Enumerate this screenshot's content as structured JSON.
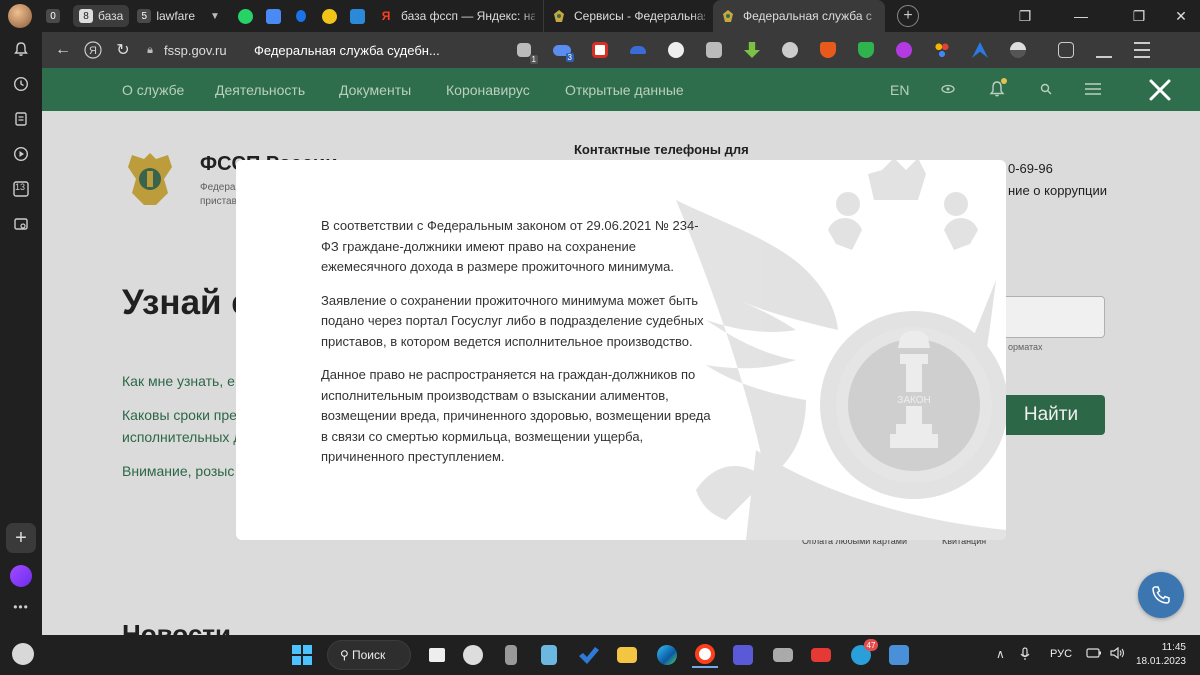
{
  "browser": {
    "tab_groups": [
      {
        "count": "0",
        "label": ""
      },
      {
        "count": "8",
        "label": "база"
      },
      {
        "count": "5",
        "label": "lawfare"
      }
    ],
    "tabs": [
      {
        "title": "база фссп — Яндекс: наш",
        "favicon": "yandex-icon",
        "color": "#fc3f1d"
      },
      {
        "title": "Сервисы - Федеральная с",
        "favicon": "fssp-emblem-icon",
        "color": "#c9a640"
      },
      {
        "title": "Федеральная служба с",
        "favicon": "fssp-emblem-icon",
        "color": "#c9a640"
      }
    ],
    "address": {
      "url": "fssp.gov.ru",
      "page_title": "Федеральная служба судебн..."
    },
    "extension_badge": "1",
    "cloud_badge": "3"
  },
  "sidebar": {
    "badge_number": "13"
  },
  "site": {
    "nav": [
      "О службе",
      "Деятельность",
      "Документы",
      "Коронавирус",
      "Открытые данные"
    ],
    "lang": "EN",
    "org_title": "ФССП России",
    "org_subtitle_lines": [
      "Федера",
      "пристав"
    ],
    "contacts_title": "Контактные телефоны для",
    "phone": "0-69-96",
    "corruption_text": "ние о коррупции",
    "hero_title": "Узнай с",
    "faq_links": [
      "Как мне узнать, е",
      "Каковы сроки пре",
      "исполнительных д",
      "Внимание, розыс"
    ],
    "formats_text": "орматах",
    "find_button": "Найти",
    "pay_links": [
      "Оплата любыми картами",
      "Квитанция"
    ],
    "news_title": "Новости"
  },
  "modal": {
    "paragraphs": [
      "В соответствии с Федеральным законом от 29.06.2021 № 234-ФЗ граждане-должники имеют право на сохранение ежемесячного дохода в размере прожиточного минимума.",
      "Заявление о сохранении прожиточного минимума может быть подано через портал Госуслуг либо в подразделение судебных приставов, в котором ведется исполнительное производство.",
      "Данное право не распространяется на граждан-должников по исполнительным производствам о взыскании алиментов, возмещении вреда, причиненного здоровью, возмещении вреда в связи со смертью кормильца, возмещении ущерба, причиненного преступлением."
    ],
    "emblem_word": "ЗАКОН"
  },
  "taskbar": {
    "search_label": "Поиск",
    "telegram_badge": "47",
    "language": "РУС",
    "time": "11:45",
    "date": "18.01.2023"
  },
  "colors": {
    "site_green": "#2f6e4c",
    "nav_text": "#b9d0c1",
    "phone_button": "#3b76b0"
  }
}
